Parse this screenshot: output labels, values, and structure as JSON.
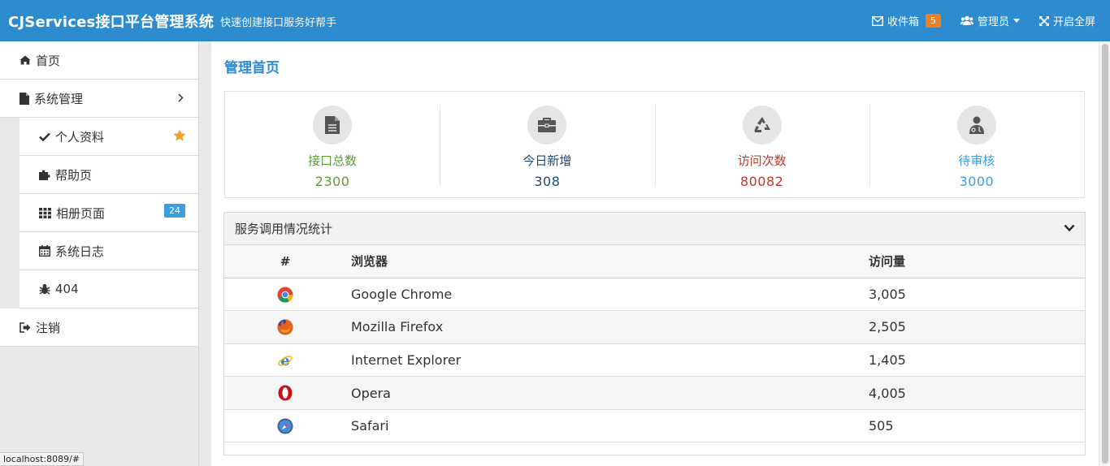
{
  "header": {
    "title": "CJServices接口平台管理系统",
    "subtitle": "快速创建接口服务好帮手",
    "inbox_label": "收件箱",
    "inbox_count": "5",
    "admin_label": "管理员",
    "fullscreen_label": "开启全屏"
  },
  "sidebar": {
    "home": "首页",
    "system": "系统管理",
    "sub_items": [
      {
        "label": "个人资料",
        "icon": "check-icon"
      },
      {
        "label": "帮助页",
        "icon": "puzzle-icon"
      },
      {
        "label": "相册页面",
        "icon": "grid-icon",
        "badge": "24"
      },
      {
        "label": "系统日志",
        "icon": "calendar-icon"
      },
      {
        "label": "404",
        "icon": "bug-icon"
      }
    ],
    "logout": "注销"
  },
  "main": {
    "page_title": "管理首页",
    "stats": [
      {
        "label": "接口总数",
        "value": "2300",
        "color": "#5f9b3a",
        "icon": "file-icon"
      },
      {
        "label": "今日新增",
        "value": "308",
        "color": "#1f4a73",
        "icon": "briefcase-icon"
      },
      {
        "label": "访问次数",
        "value": "80082",
        "color": "#c0392b",
        "icon": "recycle-icon"
      },
      {
        "label": "待审核",
        "value": "3000",
        "color": "#3a9ee0",
        "icon": "user-md-icon"
      }
    ],
    "panel": {
      "title": "服务调用情况统计",
      "columns": [
        "#",
        "浏览器",
        "访问量"
      ],
      "rows": [
        {
          "browser": "Google Chrome",
          "visits": "3,005",
          "icon": "chrome-icon"
        },
        {
          "browser": "Mozilla Firefox",
          "visits": "2,505",
          "icon": "firefox-icon"
        },
        {
          "browser": "Internet Explorer",
          "visits": "1,405",
          "icon": "ie-icon"
        },
        {
          "browser": "Opera",
          "visits": "4,005",
          "icon": "opera-icon"
        },
        {
          "browser": "Safari",
          "visits": "505",
          "icon": "safari-icon"
        }
      ]
    }
  },
  "statusbar": {
    "url": "localhost:8089/#"
  },
  "colors": {
    "brand": "#2d8ccd",
    "badge_orange": "#f07e22",
    "badge_blue": "#3a9ee0",
    "star": "#f0a030"
  }
}
